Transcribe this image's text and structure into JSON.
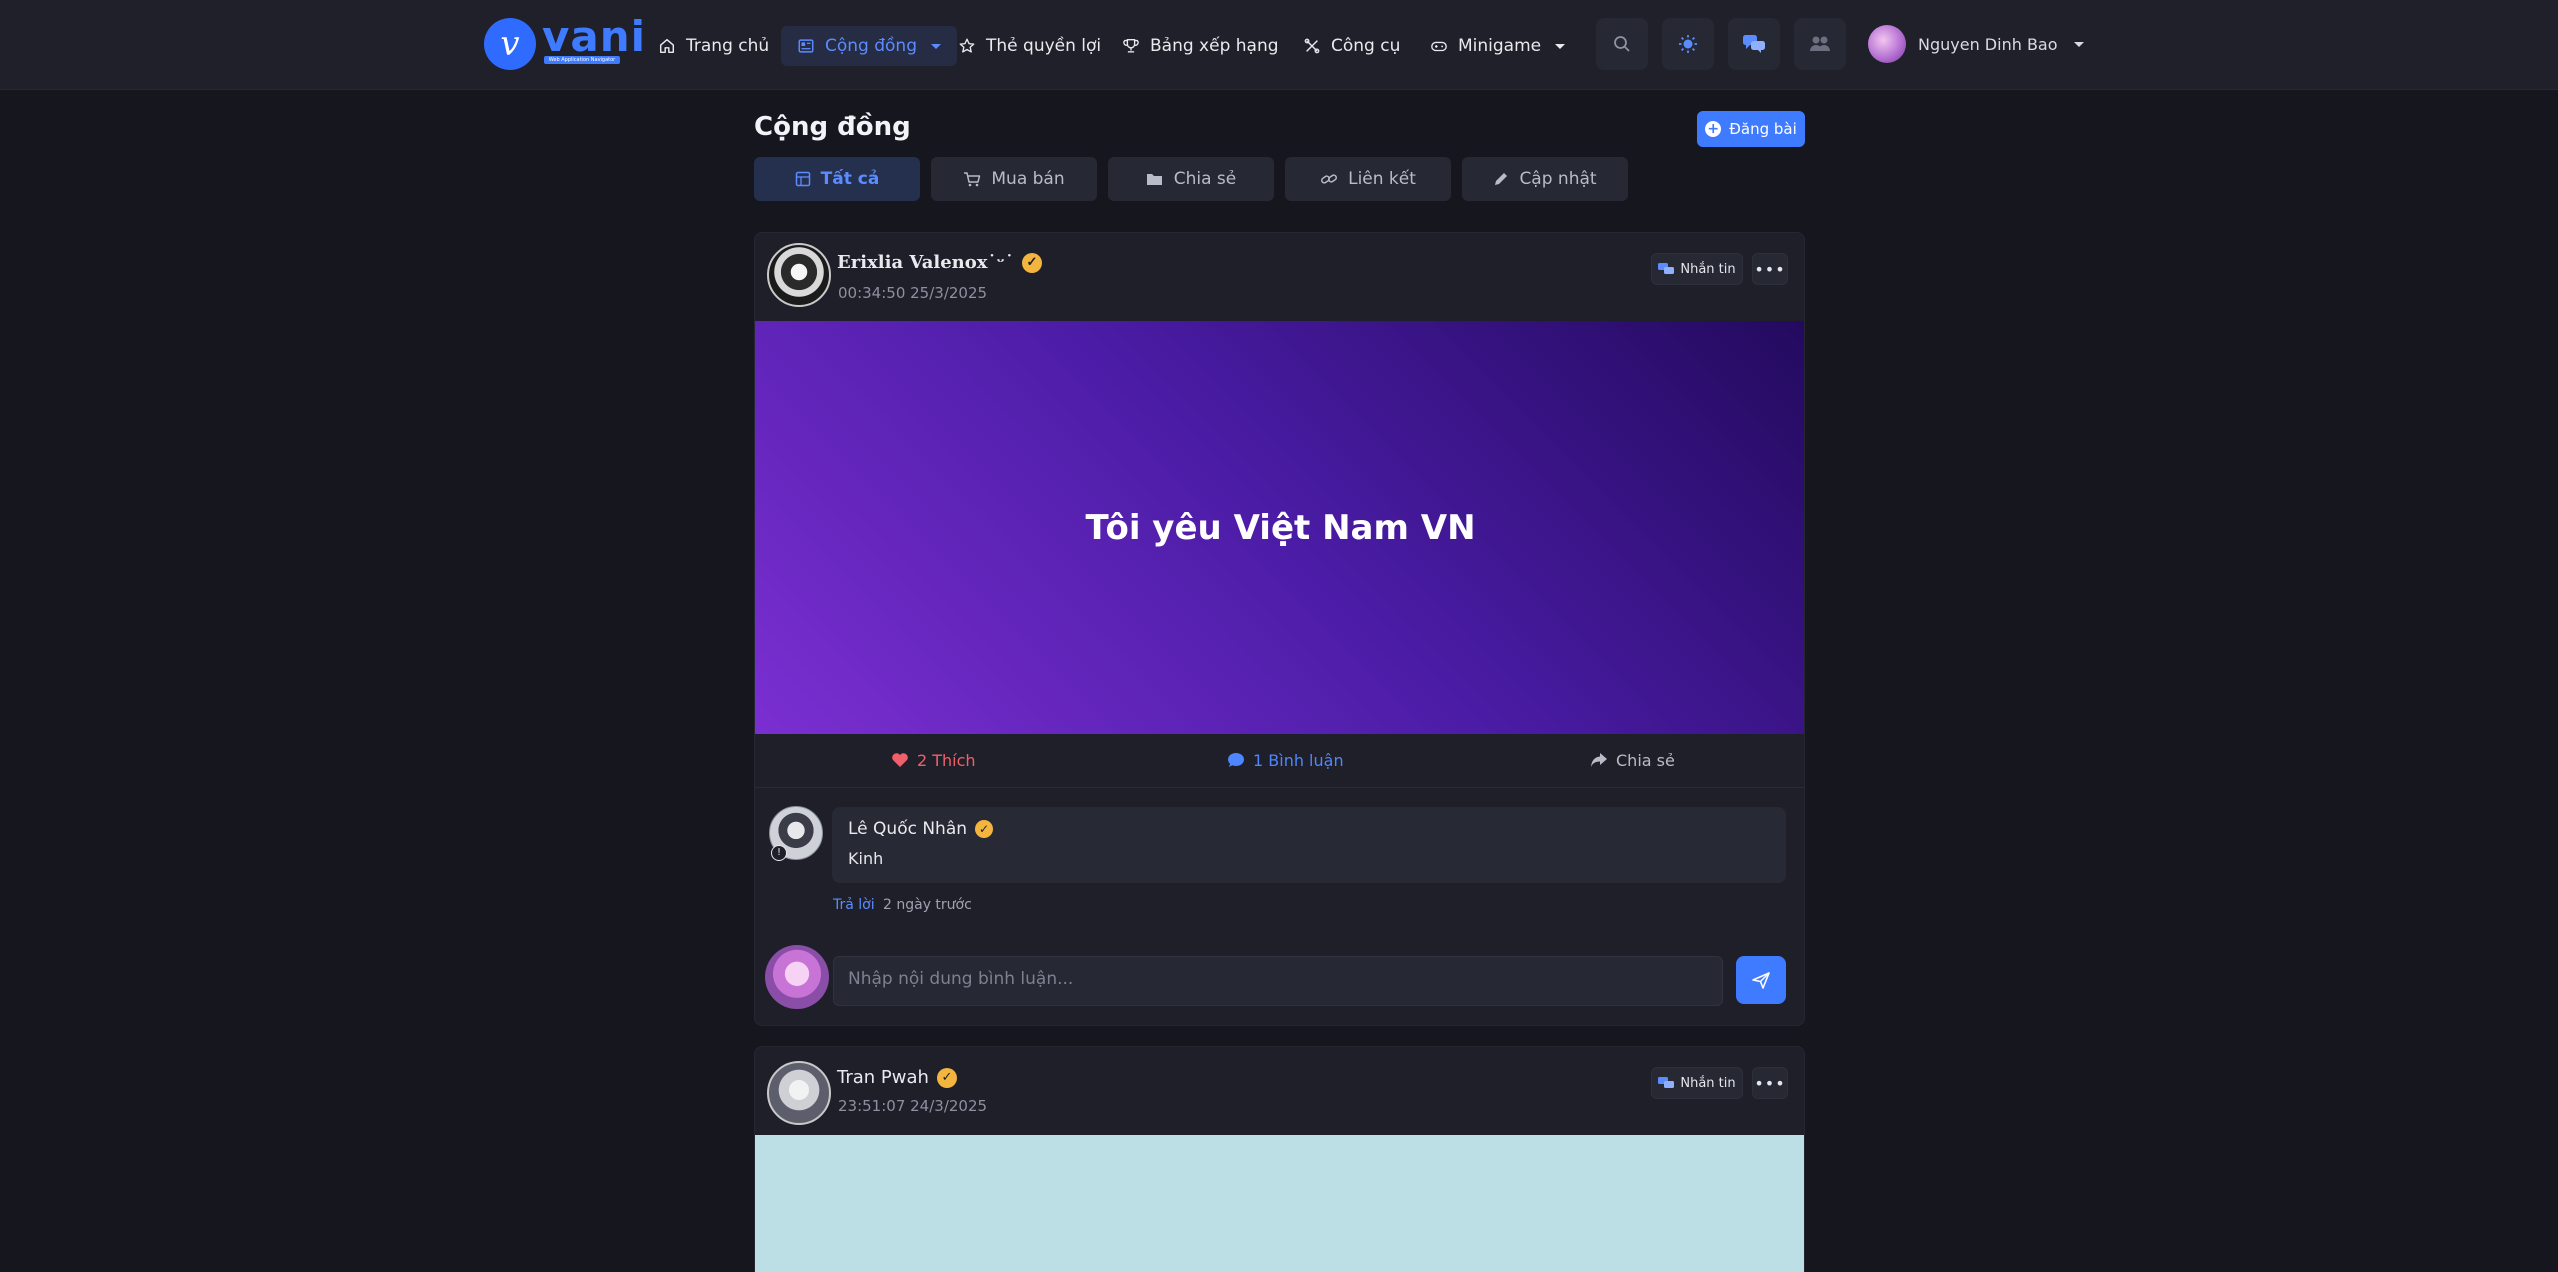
{
  "brand": {
    "name": "vani",
    "tagline": "Web Application Navigator"
  },
  "nav": {
    "items": [
      {
        "label": "Trang chủ",
        "icon": "home-icon"
      },
      {
        "label": "Cộng đồng",
        "icon": "newspaper-icon",
        "active": true
      },
      {
        "label": "Thẻ quyền lợi",
        "icon": "star-icon"
      },
      {
        "label": "Bảng xếp hạng",
        "icon": "trophy-icon"
      },
      {
        "label": "Công cụ",
        "icon": "tools-icon"
      },
      {
        "label": "Minigame",
        "icon": "gamepad-icon"
      }
    ],
    "user_name": "Nguyen Dinh Bao"
  },
  "page": {
    "title": "Cộng đồng",
    "post_button": "Đăng bài",
    "filters": [
      {
        "label": "Tất cả",
        "icon": "grid-icon",
        "active": true
      },
      {
        "label": "Mua bán",
        "icon": "cart-icon"
      },
      {
        "label": "Chia sẻ",
        "icon": "folder-icon"
      },
      {
        "label": "Liên kết",
        "icon": "link-icon"
      },
      {
        "label": "Cập nhật",
        "icon": "pencil-icon"
      }
    ]
  },
  "posts": [
    {
      "author": "Erixlia Valenox˙ᵕ˙",
      "time": "00:34:50 25/3/2025",
      "message_button": "Nhắn tin",
      "image_text": "Tôi yêu Việt Nam VN",
      "image_gradient": [
        "#7b2fd1",
        "#230a5e"
      ],
      "likes": "2 Thích",
      "comments": "1 Bình luận",
      "share": "Chia sẻ",
      "comment_list": [
        {
          "author": "Lê Quốc Nhân",
          "text": "Kinh",
          "reply": "Trả lời",
          "time": "2 ngày trước"
        }
      ],
      "comment_placeholder": "Nhập nội dung bình luận..."
    },
    {
      "author": "Tran Pwah",
      "time": "23:51:07 24/3/2025",
      "message_button": "Nhắn tin",
      "image_color": "#bcdfe6"
    }
  ],
  "colors": {
    "accent": "#3f7bff",
    "like": "#f0606a",
    "verified": "#f4b53f"
  }
}
